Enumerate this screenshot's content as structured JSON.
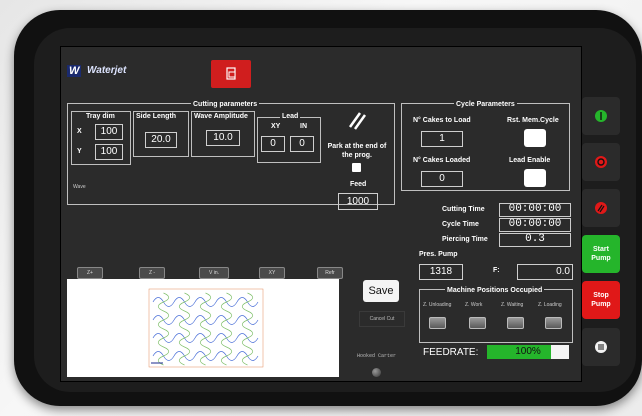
{
  "header": {
    "logo_text": "Waterjet",
    "logo_mark": "W"
  },
  "cutting_parameters": {
    "title": "Cutting parameters",
    "tray_dim": {
      "label": "Tray dim",
      "x_label": "X",
      "x_value": "100",
      "y_label": "Y",
      "y_value": "100"
    },
    "side_length": {
      "label": "Side Length",
      "value": "20.0"
    },
    "wave_amplitude": {
      "label": "Wave Amplitude",
      "value": "10.0"
    },
    "lead": {
      "label": "Lead",
      "xy_label": "XY",
      "in_label": "IN",
      "xy_value": "0",
      "in_value": "0"
    },
    "park_label": "Park at the end of the prog.",
    "feed_label": "Feed",
    "feed_value": "1000",
    "wave_label": "Wave"
  },
  "cycle_parameters": {
    "title": "Cycle Parameters",
    "cakes_to_load_label": "N° Cakes to Load",
    "cakes_to_load_value": "1",
    "rst_mem_label": "Rst. Mem.Cycle",
    "cakes_loaded_label": "N° Cakes Loaded",
    "cakes_loaded_value": "0",
    "lead_enable_label": "Lead Enable"
  },
  "tabs": [
    "Z+",
    "Z -",
    "V in.",
    "XY",
    "Refr"
  ],
  "buttons": {
    "save": "Save",
    "cancel_cut": "Cancel Cut"
  },
  "hooked_carter_label": "Hooked Carter",
  "times": {
    "cutting_time_label": "Cutting Time",
    "cutting_time_value": "00:00:00",
    "cycle_time_label": "Cycle Time",
    "cycle_time_value": "00:00:00",
    "piercing_time_label": "Piercing Time",
    "piercing_time_value": "0.3"
  },
  "pres_pump": {
    "label": "Pres. Pump",
    "value": "1318",
    "f_label": "F:",
    "f_value": "0.0"
  },
  "machine_positions": {
    "title": "Machine Positions Occupied",
    "labels": [
      "Z. Unloading",
      "Z. Work",
      "Z. Waiting",
      "Z. Loading"
    ]
  },
  "feedrate": {
    "label": "FEEDRATE:",
    "value_text": "100%",
    "fraction": 1.0
  },
  "side_panel": {
    "start_pump": "Start Pump",
    "stop_pump": "Stop Pump"
  },
  "colors": {
    "green": "#25b52b",
    "red": "#e01818",
    "header_red": "#d01e1e",
    "logo_blue": "#1a2a6e"
  }
}
